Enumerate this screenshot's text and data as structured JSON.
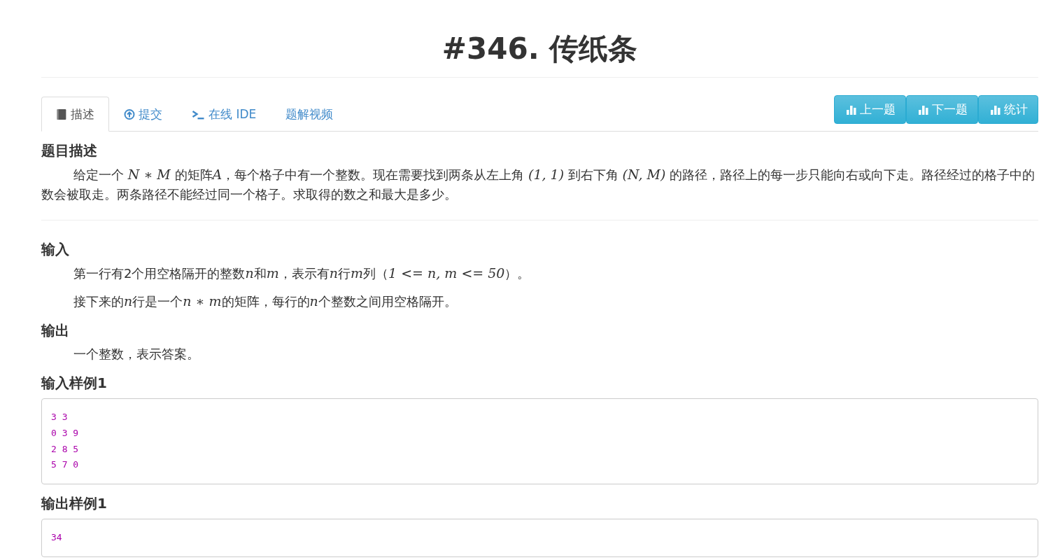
{
  "title": "#346. 传纸条",
  "tabs": [
    {
      "label": "描述",
      "kind": "book",
      "selected": true
    },
    {
      "label": "提交",
      "kind": "upload",
      "selected": false
    },
    {
      "label": "在线 IDE",
      "kind": "terminal",
      "selected": false
    },
    {
      "label": "题解视频",
      "kind": "plain",
      "selected": false
    }
  ],
  "buttons": [
    {
      "label": "上一题"
    },
    {
      "label": "下一题"
    },
    {
      "label": "统计"
    }
  ],
  "sections": [
    {
      "kind": "text",
      "heading": "题目描述",
      "paragraphs": [
        [
          {
            "kind": "text",
            "text": "给定一个 "
          },
          {
            "kind": "math",
            "text": "N ∗ M"
          },
          {
            "kind": "text",
            "text": " 的矩阵"
          },
          {
            "kind": "math",
            "text": "A"
          },
          {
            "kind": "text",
            "text": "，每个格子中有一个整数。现在需要找到两条从左上角 "
          },
          {
            "kind": "math",
            "text": "(1, 1)"
          },
          {
            "kind": "text",
            "text": " 到右下角 "
          },
          {
            "kind": "math",
            "text": "(N, M)"
          },
          {
            "kind": "text",
            "text": " 的路径，路径上的每一步只能向右或向下走。路径经过的格子中的数会被取走。两条路径不能经过同一个格子。求取得的数之和最大是多少。"
          }
        ]
      ]
    },
    {
      "kind": "divider"
    },
    {
      "kind": "text",
      "heading": "输入",
      "paragraphs": [
        [
          {
            "kind": "text",
            "text": "第一行有2个用空格隔开的整数"
          },
          {
            "kind": "math",
            "text": "n"
          },
          {
            "kind": "text",
            "text": "和"
          },
          {
            "kind": "math",
            "text": "m"
          },
          {
            "kind": "text",
            "text": "，表示有"
          },
          {
            "kind": "math",
            "text": "n"
          },
          {
            "kind": "text",
            "text": "行"
          },
          {
            "kind": "math",
            "text": "m"
          },
          {
            "kind": "text",
            "text": "列（"
          },
          {
            "kind": "math",
            "text": "1 <= n, m <= 50"
          },
          {
            "kind": "text",
            "text": "）。"
          }
        ],
        [
          {
            "kind": "text",
            "text": "接下来的"
          },
          {
            "kind": "math",
            "text": "n"
          },
          {
            "kind": "text",
            "text": "行是一个"
          },
          {
            "kind": "math",
            "text": "n ∗ m"
          },
          {
            "kind": "text",
            "text": "的矩阵，每行的"
          },
          {
            "kind": "math",
            "text": "n"
          },
          {
            "kind": "text",
            "text": "个整数之间用空格隔开。"
          }
        ]
      ]
    },
    {
      "kind": "text",
      "heading": "输出",
      "paragraphs": [
        [
          {
            "kind": "text",
            "text": "一个整数，表示答案。"
          }
        ]
      ]
    },
    {
      "kind": "code",
      "heading": "输入样例1",
      "code": "3 3\n0 3 9\n2 8 5\n5 7 0"
    },
    {
      "kind": "code",
      "heading": "输出样例1",
      "code": "34"
    }
  ]
}
